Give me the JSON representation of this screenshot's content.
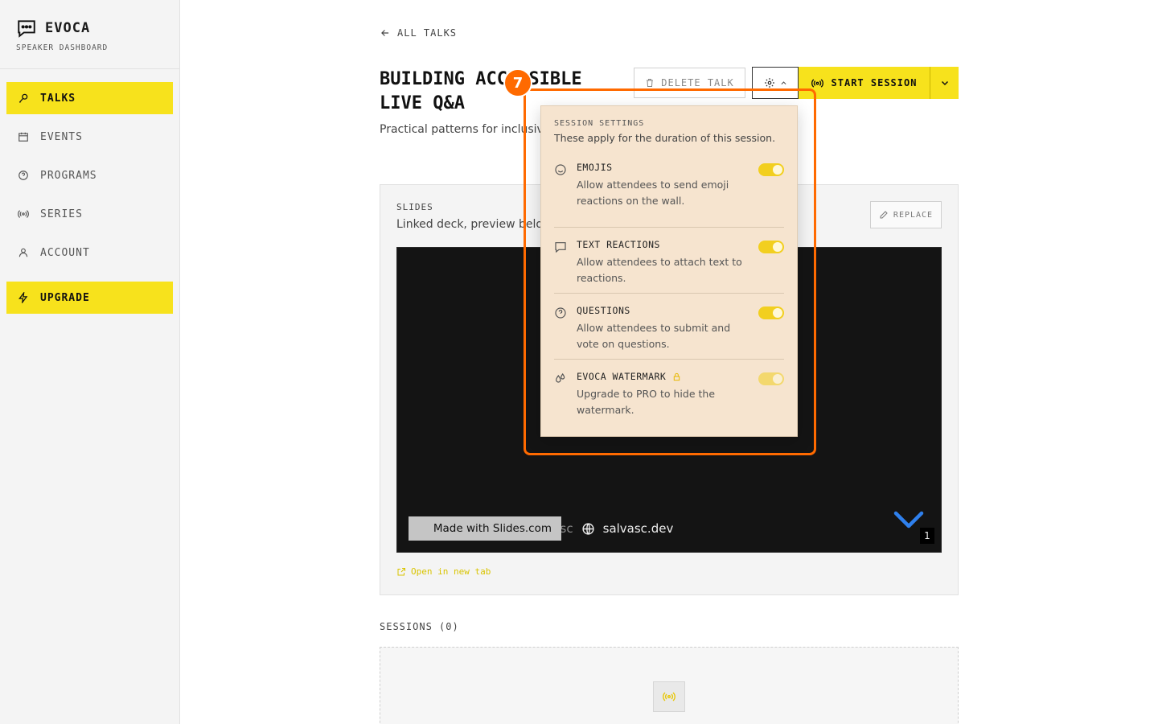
{
  "brand": {
    "name": "EVOCA",
    "subtitle": "SPEAKER DASHBOARD"
  },
  "sidebar": {
    "items": [
      {
        "label": "TALKS",
        "icon": "microphone-icon",
        "active": true
      },
      {
        "label": "EVENTS",
        "icon": "calendar-icon",
        "active": false
      },
      {
        "label": "PROGRAMS",
        "icon": "help-circle-icon",
        "active": false
      },
      {
        "label": "SERIES",
        "icon": "broadcast-icon",
        "active": false
      },
      {
        "label": "ACCOUNT",
        "icon": "user-icon",
        "active": false
      }
    ],
    "upgrade": {
      "label": "UPGRADE",
      "icon": "lightning-icon"
    }
  },
  "header": {
    "back_label": "ALL TALKS",
    "title": "BUILDING ACCESSIBLE LIVE Q&A",
    "description": "Practical patterns for inclusive moderation, and hybrid audien",
    "delete_label": "DELETE TALK",
    "start_label": "START SESSION"
  },
  "slides": {
    "label": "SLIDES",
    "sub": "Linked deck, preview belo",
    "replace_label": "REPLACE",
    "preview": {
      "made_with": "Made with Slides.com",
      "social_handle": "salvador-sc",
      "social_site": "salvasc.dev",
      "slide_number": "1"
    },
    "open_tab_label": "Open in new tab"
  },
  "sessions": {
    "label": "SESSIONS (0)"
  },
  "settings_dropdown": {
    "title": "SESSION SETTINGS",
    "subtitle": "These apply for the duration of this session.",
    "items": [
      {
        "name": "EMOJIS",
        "text": "Allow attendees to send emoji reactions on the wall.",
        "enabled": true,
        "locked": false
      },
      {
        "name": "TEXT REACTIONS",
        "text": "Allow attendees to attach text to reactions.",
        "enabled": true,
        "locked": false
      },
      {
        "name": "QUESTIONS",
        "text": "Allow attendees to submit and vote on questions.",
        "enabled": true,
        "locked": false
      },
      {
        "name": "EVOCA WATERMARK",
        "text": "Upgrade to PRO to hide the watermark.",
        "enabled": true,
        "locked": true
      }
    ]
  },
  "annotation": {
    "marker": "7"
  },
  "colors": {
    "accent": "#f7e21c",
    "highlight": "#ff6a00",
    "dropdown_bg": "#f6e4cf"
  }
}
